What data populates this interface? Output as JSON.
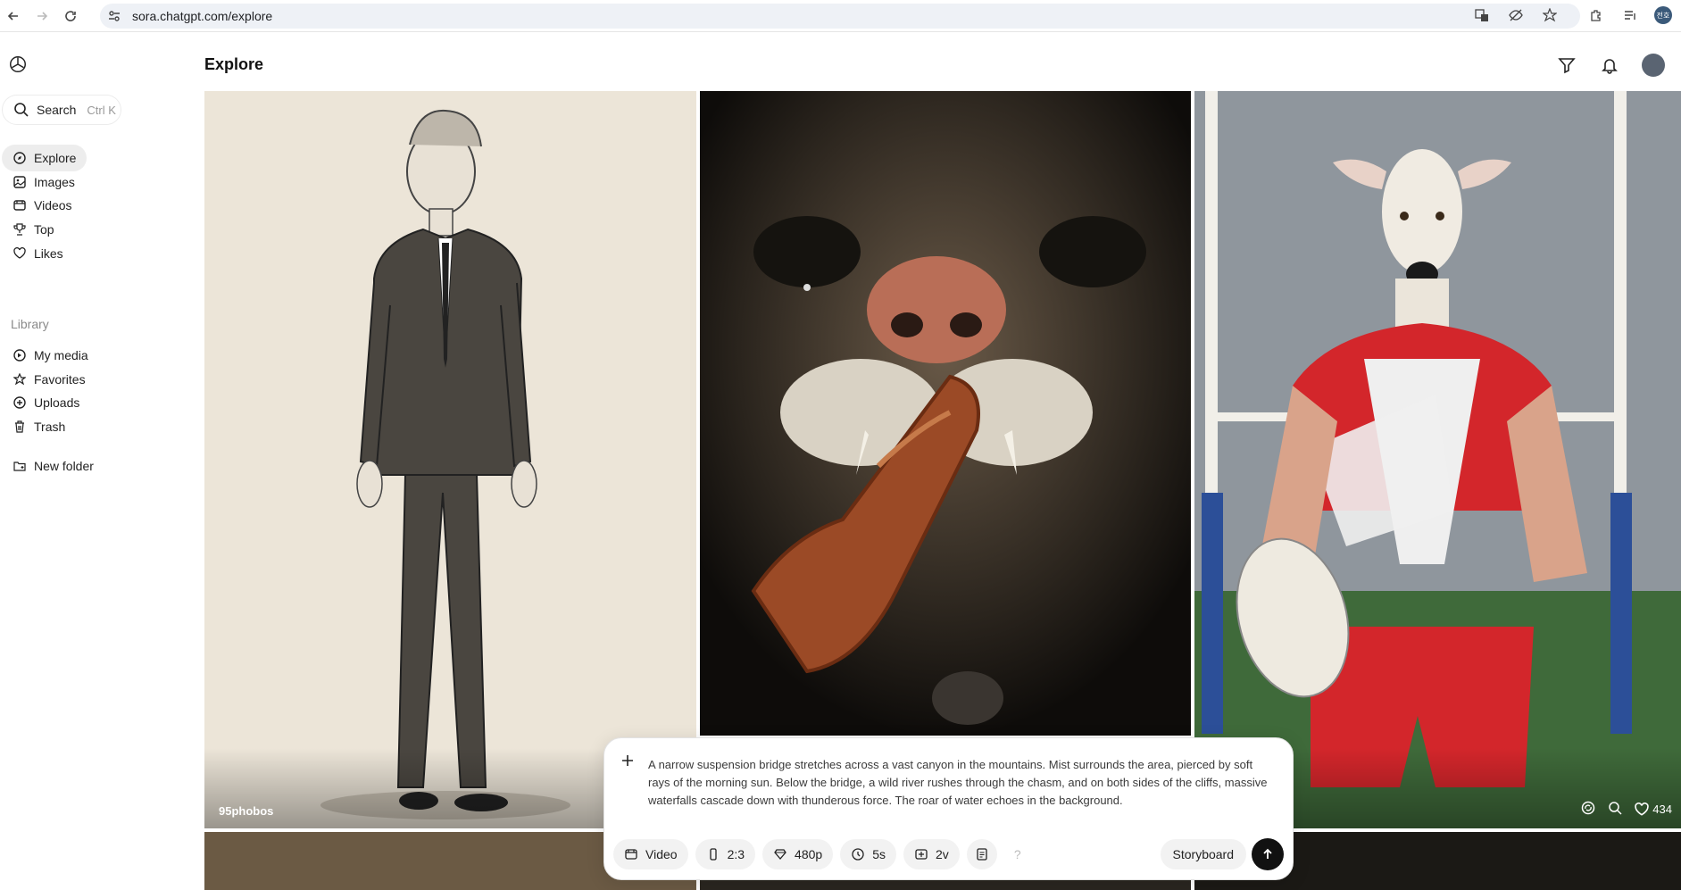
{
  "browser": {
    "url": "sora.chatgpt.com/explore",
    "profile_initials": "전호"
  },
  "sidebar": {
    "search": {
      "label": "Search",
      "shortcut": "Ctrl K"
    },
    "nav_items": [
      {
        "label": "Explore",
        "icon": "compass-icon",
        "active": true
      },
      {
        "label": "Images",
        "icon": "images-icon",
        "active": false
      },
      {
        "label": "Videos",
        "icon": "videos-icon",
        "active": false
      },
      {
        "label": "Top",
        "icon": "trophy-icon",
        "active": false
      },
      {
        "label": "Likes",
        "icon": "heart-icon",
        "active": false
      }
    ],
    "library_label": "Library",
    "library_items": [
      {
        "label": "My media",
        "icon": "media-icon"
      },
      {
        "label": "Favorites",
        "icon": "star-icon"
      },
      {
        "label": "Uploads",
        "icon": "upload-icon"
      },
      {
        "label": "Trash",
        "icon": "trash-icon"
      }
    ],
    "new_folder_label": "New folder"
  },
  "header": {
    "title": "Explore"
  },
  "gallery": {
    "tiles": [
      {
        "username": "95phobos",
        "subject": "sketch of a man in a suit",
        "likes": ""
      },
      {
        "username": "",
        "subject": "cat eating sausage close-up",
        "likes": ""
      },
      {
        "username": "",
        "subject": "greyhound rugby player",
        "likes": "434"
      }
    ]
  },
  "composer": {
    "prompt": "A narrow suspension bridge stretches across a vast canyon in the mountains. Mist surrounds the area, pierced by soft rays of the morning sun. Below the bridge, a wild river rushes through the chasm, and on both sides of the cliffs, massive waterfalls cascade down with thunderous force. The roar of water echoes in the background.",
    "chips": {
      "type": "Video",
      "aspect": "2:3",
      "resolution": "480p",
      "duration": "5s",
      "variations": "2v"
    },
    "help_glyph": "?",
    "storyboard_label": "Storyboard"
  }
}
